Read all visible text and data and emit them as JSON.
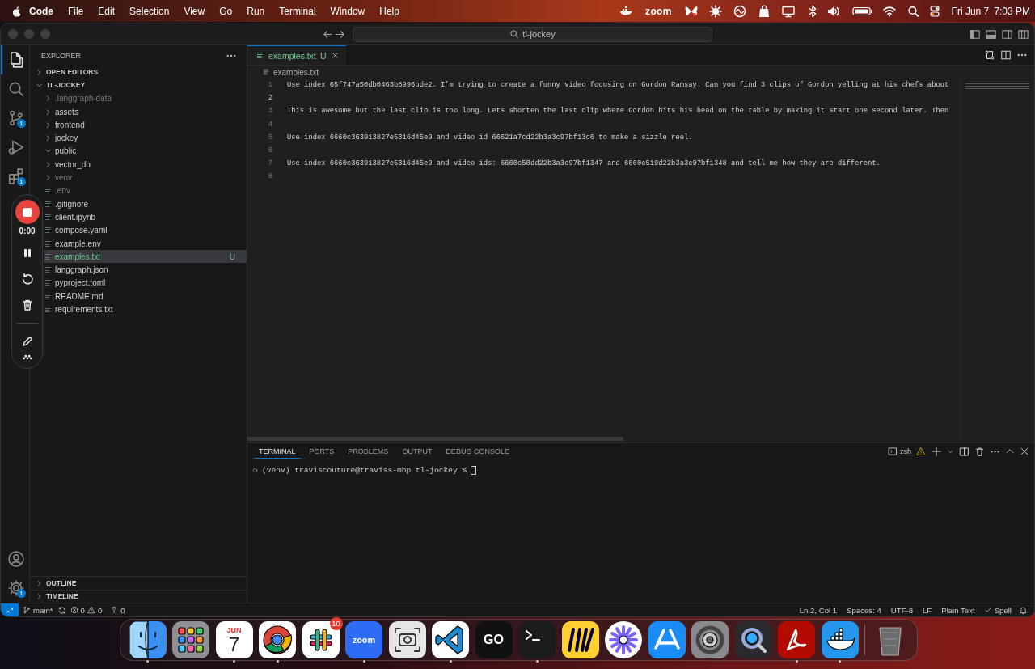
{
  "menubar": {
    "app": "Code",
    "menus": [
      "File",
      "Edit",
      "Selection",
      "View",
      "Go",
      "Run",
      "Terminal",
      "Window",
      "Help"
    ],
    "zoom_label": "zoom",
    "date": "Fri Jun 7",
    "time": "7:03 PM"
  },
  "titlebar": {
    "search": "tl-jockey"
  },
  "activity_bar": {
    "items": [
      {
        "kind": "files",
        "selected": true
      },
      {
        "kind": "search",
        "selected": false
      },
      {
        "kind": "scm",
        "selected": false,
        "badge": "1"
      },
      {
        "kind": "run",
        "selected": false
      },
      {
        "kind": "extensions",
        "selected": false,
        "badge": "1"
      }
    ],
    "settings_badge": "1"
  },
  "sidebar": {
    "title": "EXPLORER",
    "sections": [
      {
        "label": "OPEN EDITORS",
        "expanded": false
      },
      {
        "label": "TL-JOCKEY",
        "expanded": true,
        "children": [
          {
            "name": ".langgraph-data",
            "kind": "folder",
            "expanded": false,
            "ignored": true,
            "selected": false
          },
          {
            "name": "assets",
            "kind": "folder",
            "expanded": false,
            "ignored": false,
            "selected": false
          },
          {
            "name": "frontend",
            "kind": "folder",
            "expanded": false,
            "ignored": false,
            "selected": false
          },
          {
            "name": "jockey",
            "kind": "folder",
            "expanded": false,
            "ignored": false,
            "selected": false
          },
          {
            "name": "public",
            "kind": "folder",
            "expanded": true,
            "ignored": false,
            "selected": false
          },
          {
            "name": "vector_db",
            "kind": "folder",
            "expanded": false,
            "ignored": false,
            "selected": false
          },
          {
            "name": "venv",
            "kind": "folder",
            "expanded": false,
            "ignored": true,
            "selected": false
          },
          {
            "name": ".env",
            "kind": "file",
            "ignored": true,
            "selected": false
          },
          {
            "name": ".gitignore",
            "kind": "file",
            "ignored": false,
            "selected": false
          },
          {
            "name": "client.ipynb",
            "kind": "file",
            "ignored": false,
            "selected": false
          },
          {
            "name": "compose.yaml",
            "kind": "file",
            "ignored": false,
            "selected": false
          },
          {
            "name": "example.env",
            "kind": "file",
            "ignored": false,
            "selected": false
          },
          {
            "name": "examples.txt",
            "kind": "file",
            "ignored": false,
            "selected": true,
            "status": "U"
          },
          {
            "name": "langgraph.json",
            "kind": "file",
            "ignored": false,
            "selected": false
          },
          {
            "name": "pyproject.toml",
            "kind": "file",
            "ignored": false,
            "selected": false
          },
          {
            "name": "README.md",
            "kind": "file",
            "ignored": false,
            "selected": false
          },
          {
            "name": "requirements.txt",
            "kind": "file",
            "ignored": false,
            "selected": false
          }
        ]
      }
    ],
    "footer_sections": [
      {
        "label": "OUTLINE",
        "expanded": false
      },
      {
        "label": "TIMELINE",
        "expanded": false
      }
    ]
  },
  "editor": {
    "tabs": [
      {
        "label": "examples.txt",
        "status": "U",
        "selected": true
      }
    ],
    "breadcrumb": "examples.txt",
    "lines": [
      {
        "number": "1",
        "current": false,
        "text": "Use index 65f747a50db0463b8996bde2. I'm trying to create a funny video focusing on Gordon Ramsay. Can you find 3 clips of Gordon yelling at his chefs about"
      },
      {
        "number": "2",
        "current": true
      },
      {
        "number": "3",
        "current": false,
        "text": "This is awesome but the last clip is too long. Lets shorten the last clip where Gordon hits his head on the table by making it start one second later. Then"
      },
      {
        "number": "4",
        "current": false
      },
      {
        "number": "5",
        "current": false,
        "text": "Use index 6660c363913827e5316d45e9 and video id 66621a7cd22b3a3c97bf13c6 to make a sizzle reel."
      },
      {
        "number": "6",
        "current": false
      },
      {
        "number": "7",
        "current": false,
        "text": "Use index 6660c363913827e5316d45e9 and video ids: 6660c50dd22b3a3c97bf1347 and 6660c519d22b3a3c97bf1348 and tell me how they are different."
      },
      {
        "number": "8",
        "current": false
      }
    ]
  },
  "panel": {
    "tabs": [
      {
        "label": "TERMINAL",
        "selected": true
      },
      {
        "label": "PORTS",
        "selected": false
      },
      {
        "label": "PROBLEMS",
        "selected": false
      },
      {
        "label": "OUTPUT",
        "selected": false
      },
      {
        "label": "DEBUG CONSOLE",
        "selected": false
      }
    ],
    "shell": "zsh",
    "prompt": "(venv) traviscouture@traviss-mbp tl-jockey %"
  },
  "status_bar": {
    "branch": "main*",
    "errors": "0",
    "warnings": "0",
    "ports": "0",
    "items": [
      "Ln 2, Col 1",
      "Spaces: 4",
      "UTF-8",
      "LF",
      "Plain Text"
    ],
    "spell": "Spell"
  },
  "recorder": {
    "time": "0:00"
  },
  "dock": {
    "items": [
      {
        "kind": "face",
        "color": "#3b8ff0",
        "running": true
      },
      {
        "kind": "grid",
        "color": "#8e8e93",
        "running": false
      },
      {
        "kind": "calendar",
        "color": "#ffffff",
        "running": true,
        "month": "JUN",
        "day": "7"
      },
      {
        "kind": "wheel",
        "color": "#ffffff",
        "running": true
      },
      {
        "kind": "hash",
        "color": "#ffffff",
        "running": false,
        "badge": "10"
      },
      {
        "kind": "label",
        "color": "#2d6cf5",
        "running": true,
        "label": "zoom"
      },
      {
        "kind": "camera",
        "color": "#e6e6e6",
        "running": false
      },
      {
        "kind": "ribbon",
        "color": "#ffffff",
        "running": true
      },
      {
        "kind": "label",
        "color": "#111111",
        "running": false,
        "label": "GO"
      },
      {
        "kind": "prompt",
        "color": "#1c1c1c",
        "running": true
      },
      {
        "kind": "scribble",
        "color": "#ffd02f",
        "running": false
      },
      {
        "kind": "flower",
        "color": "#ffffff",
        "running": false
      },
      {
        "kind": "letter",
        "color": "#1a8cf5",
        "running": false
      },
      {
        "kind": "gear",
        "color": "#8a8a8e",
        "running": false
      },
      {
        "kind": "magnifier",
        "color": "#2a2a2e",
        "running": false
      },
      {
        "kind": "document",
        "color": "#b30b00",
        "running": true
      },
      {
        "kind": "whale",
        "color": "#2496ed",
        "running": true
      },
      {
        "kind": "bin",
        "color": "#6b6b6b",
        "running": false
      }
    ]
  }
}
